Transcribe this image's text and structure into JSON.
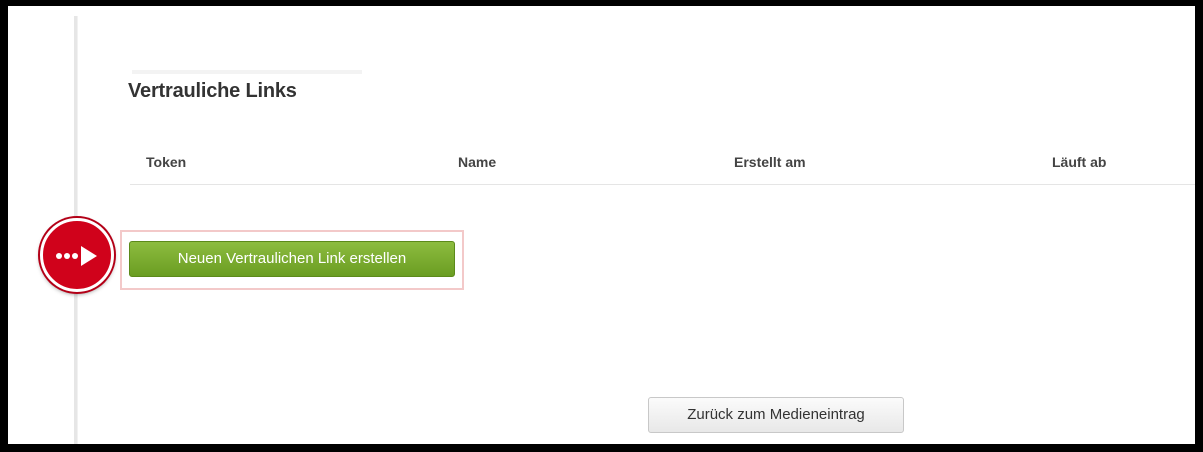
{
  "section": {
    "title": "Vertrauliche Links"
  },
  "table": {
    "columns": [
      "Token",
      "Name",
      "Erstellt am",
      "Läuft ab"
    ],
    "rows": []
  },
  "buttons": {
    "create_link": "Neuen Vertraulichen Link erstellen",
    "back_to_media": "Zurück zum Medieneintrag"
  },
  "colors": {
    "primary_button": "#7aae2e",
    "marker": "#d0021b",
    "highlight_border": "#f3c9c9"
  },
  "icons": {
    "marker": "dotted-arrow-right-icon"
  }
}
